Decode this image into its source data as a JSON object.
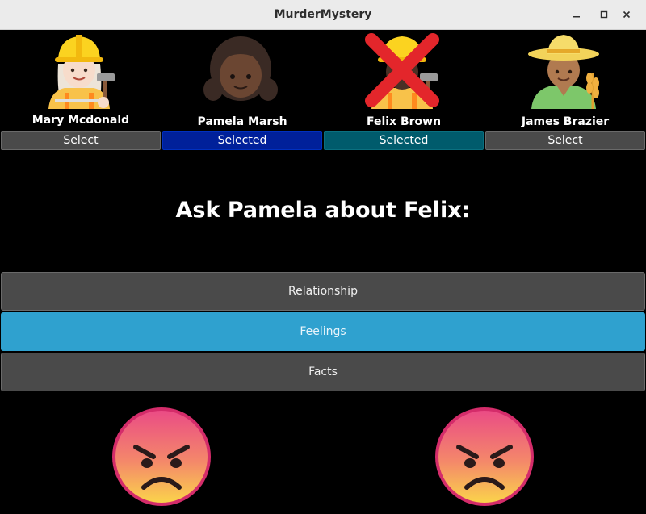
{
  "window": {
    "title": "MurderMystery"
  },
  "characters": [
    {
      "name": "Mary Mcdonald",
      "button": "Select",
      "state": "unselected",
      "avatar": "woman-construction-worker-icon",
      "crossed": false
    },
    {
      "name": "Pamela Marsh",
      "button": "Selected",
      "state": "asker",
      "avatar": "girl-icon",
      "crossed": false
    },
    {
      "name": "Felix Brown",
      "button": "Selected",
      "state": "subject",
      "avatar": "construction-worker-icon",
      "crossed": true
    },
    {
      "name": "James Brazier",
      "button": "Select",
      "state": "unselected",
      "avatar": "farmer-icon",
      "crossed": false
    }
  ],
  "question": "Ask Pamela about Felix:",
  "topics": [
    {
      "label": "Relationship",
      "active": false
    },
    {
      "label": "Feelings",
      "active": true
    },
    {
      "label": "Facts",
      "active": false
    }
  ],
  "emotions": [
    "angry-face-icon",
    "angry-face-icon"
  ],
  "colors": {
    "asker": "#00209a",
    "subject": "#005b6c",
    "active_topic": "#2fa1cf",
    "button": "#4a4a4a"
  }
}
